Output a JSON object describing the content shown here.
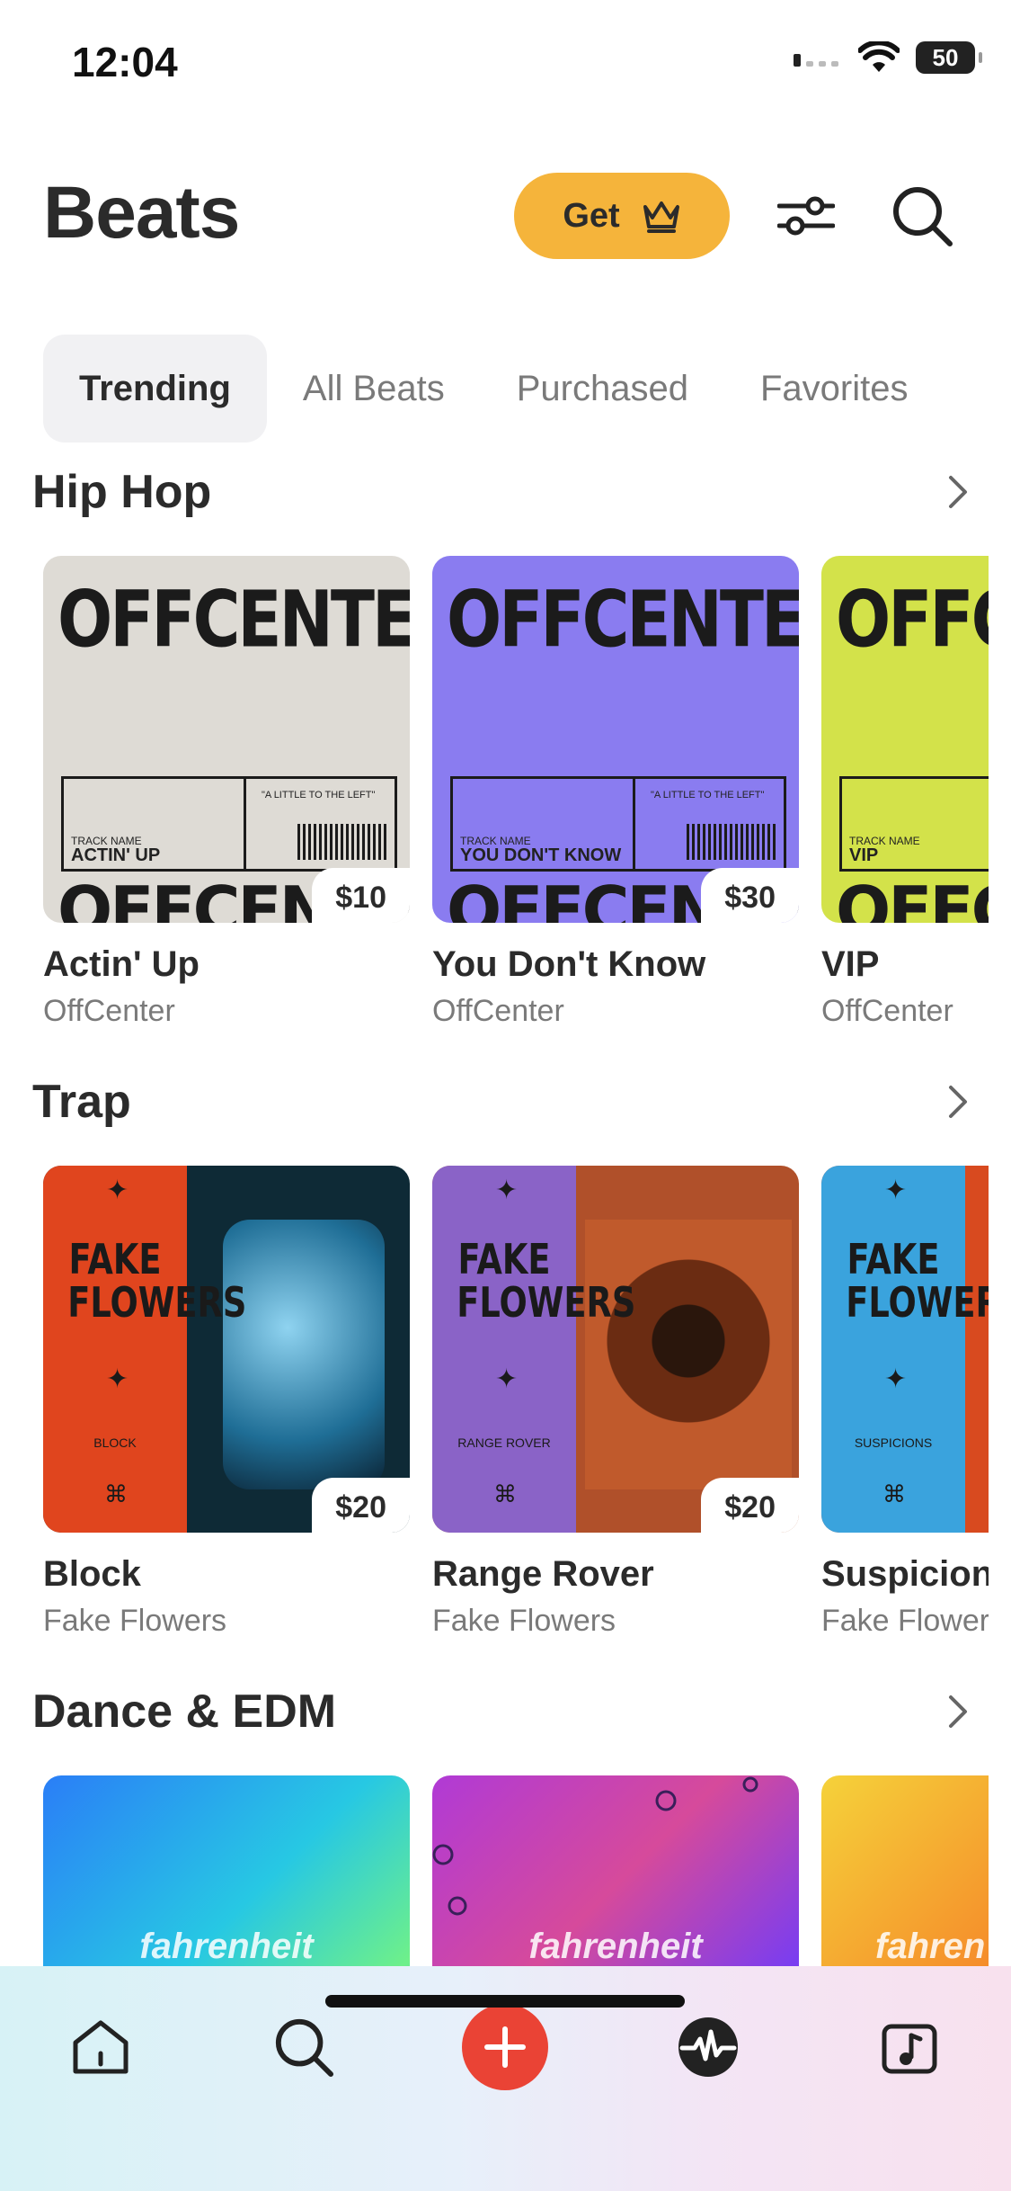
{
  "status_bar": {
    "time": "12:04",
    "battery": "50"
  },
  "header": {
    "title": "Beats",
    "get_label": "Get"
  },
  "tabs": [
    {
      "label": "Trending",
      "active": true
    },
    {
      "label": "All Beats",
      "active": false
    },
    {
      "label": "Purchased",
      "active": false
    },
    {
      "label": "Favorites",
      "active": false
    }
  ],
  "sections": [
    {
      "title": "Hip Hop",
      "items": [
        {
          "title": "Actin' Up",
          "artist": "OffCenter",
          "price": "$10",
          "cover_text": "OFFCENTER",
          "cover_track_label": "TRACK NAME",
          "cover_track": "ACTIN' UP",
          "cover_sub": "\"A LITTLE TO THE LEFT\"",
          "color": "#dedbd5"
        },
        {
          "title": "You Don't Know",
          "artist": "OffCenter",
          "price": "$30",
          "cover_text": "OFFCENTER",
          "cover_track_label": "TRACK NAME",
          "cover_track": "YOU DON'T KNOW",
          "cover_sub": "\"A LITTLE TO THE LEFT\"",
          "color": "#8a7cf0"
        },
        {
          "title": "VIP",
          "artist": "OffCenter",
          "price": "",
          "cover_text": "OFFCE",
          "cover_track_label": "TRACK NAME",
          "cover_track": "VIP",
          "cover_sub": "",
          "color": "#d3e24a"
        }
      ]
    },
    {
      "title": "Trap",
      "items": [
        {
          "title": "Block",
          "artist": "Fake Flowers",
          "price": "$20",
          "cover_text": "FAKE FLOWERS",
          "cover_name": "BLOCK",
          "strip": "#e0451e",
          "bg": "#0e2a36"
        },
        {
          "title": "Range Rover",
          "artist": "Fake Flowers",
          "price": "$20",
          "cover_text": "FAKE FLOWERS",
          "cover_name": "RANGE ROVER",
          "strip": "#8a63c7",
          "bg": "#b0502a"
        },
        {
          "title": "Suspicions",
          "artist": "Fake Flowers",
          "price": "",
          "cover_text": "FAKE FLOWERS",
          "cover_name": "SUSPICIONS",
          "strip": "#3aa3dd",
          "bg": "#d84a1f"
        }
      ]
    },
    {
      "title": "Dance & EDM",
      "items": [
        {
          "cover_text": "fahrenheit",
          "gradient": "linear-gradient(135deg,#2a7ef7 0%,#27c8e3 45%,#6ef08a 75%,#2aa6f0 100%)"
        },
        {
          "cover_text": "fahrenheit",
          "gradient": "linear-gradient(135deg,#b03ad6 0%,#d64a9b 40%,#7a3df0 75%,#5c34e0 100%)"
        },
        {
          "cover_text": "fahren",
          "gradient": "linear-gradient(135deg,#f5d23a 0%,#f58a2a 50%,#e8402a 100%)"
        }
      ]
    }
  ],
  "nav": [
    "home-icon",
    "search-icon",
    "add-icon",
    "waveform-icon",
    "music-note-icon"
  ],
  "colors": {
    "accent": "#f5b43b",
    "fab": "#ea4335"
  }
}
